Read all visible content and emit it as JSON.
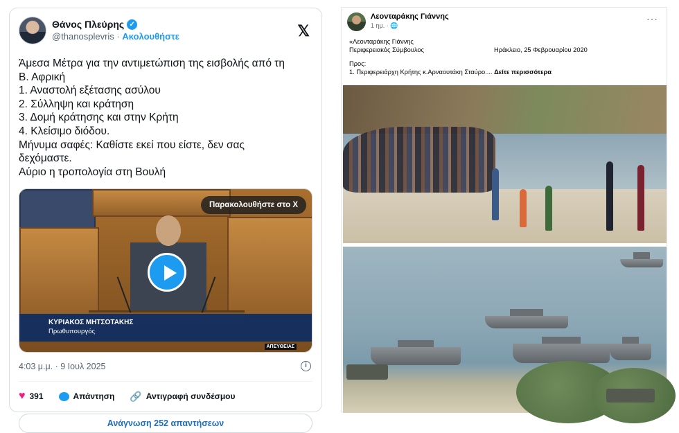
{
  "tweet": {
    "author_name": "Θάνος Πλεύρης",
    "handle": "@thanosplevris",
    "separator": "·",
    "follow_label": "Ακολουθήστε",
    "text_lines": [
      "Άμεσα Μέτρα για την αντιμετώπιση της εισβολής από τη",
      "Β. Αφρική",
      "1. Αναστολή εξέτασης ασύλου",
      "2. Σύλληψη και κράτηση",
      "3. Δομή κράτησης και στην Κρήτη",
      "4. Κλείσιμο διόδου.",
      "Μήνυμα σαφές: Καθίστε εκεί που είστε, δεν σας",
      "δεχόμαστε.",
      "Αύριο η τροπολογία στη Βουλή"
    ],
    "video": {
      "watch_badge": "Παρακολουθήστε στο X",
      "caption_name": "ΚΥΡΙΑΚΟΣ ΜΗΤΣΟΤΑΚΗΣ",
      "caption_role": "Πρωθυπουργός",
      "live_tag": "ΑΠΕΥΘΕΙΑΣ"
    },
    "timestamp": "4:03 μ.μ. · 9 Ιουλ 2025",
    "likes": "391",
    "reply_label": "Απάντηση",
    "copy_link_label": "Αντιγραφή συνδέσμου",
    "read_replies_label": "Ανάγνωση 252 απαντήσεων",
    "icons": {
      "x_logo": "𝕏",
      "verified": "✓",
      "heart": "♥",
      "link": "🔗",
      "info": "i"
    },
    "colors": {
      "accent": "#1d9bf0",
      "like": "#f91880",
      "caption_bg": "#0d2d62"
    }
  },
  "facebook": {
    "author_name": "Λεονταράκης Γιάννης",
    "time": "1 ημ. ·",
    "more": "···",
    "line1_left": "«Λεονταράκης Γιάννης",
    "line2_left": "Περιφερειακός Σύμβουλος",
    "line2_right": "Ηράκλειο, 25 Φεβρουαρίου  2020",
    "to_label": "Προς:",
    "line4": "1. Περιφερειάρχη Κρήτης κ.Αρναουτάκη Σταύρο....",
    "see_more": "Δείτε περισσότερα"
  }
}
